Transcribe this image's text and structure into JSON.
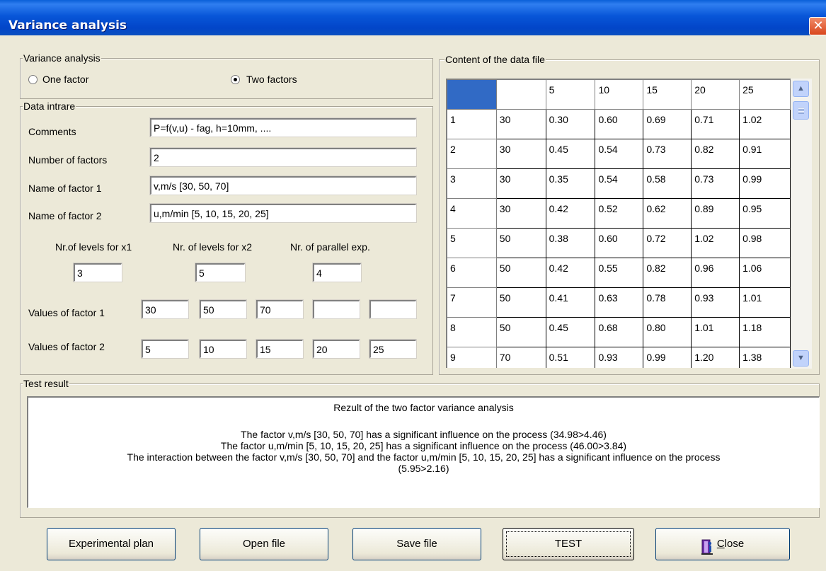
{
  "window": {
    "title": "Variance analysis",
    "close_glyph": "✕"
  },
  "variance": {
    "legend": "Variance analysis",
    "one_factor": "One factor",
    "two_factors": "Two factors",
    "selected": "two_factors"
  },
  "data_intrare": {
    "legend": "Data intrare",
    "comments_label": "Comments",
    "comments_value": "P=f(v,u) - fag, h=10mm, ....",
    "num_factors_label": "Number of factors",
    "num_factors_value": "2",
    "factor1_name_label": "Name of factor 1",
    "factor1_name_value": "v,m/s [30, 50, 70]",
    "factor2_name_label": "Name of factor 2",
    "factor2_name_value": "u,m/min [5, 10, 15, 20, 25]",
    "levels_x1_label": "Nr.of levels for x1",
    "levels_x1_value": "3",
    "levels_x2_label": "Nr. of levels for x2",
    "levels_x2_value": "5",
    "parallel_label": "Nr. of parallel exp.",
    "parallel_value": "4",
    "values_f1_label": "Values of factor 1",
    "values_f1": [
      "30",
      "50",
      "70",
      "",
      ""
    ],
    "values_f2_label": "Values of factor 2",
    "values_f2": [
      "5",
      "10",
      "15",
      "20",
      "25"
    ]
  },
  "datafile": {
    "legend": "Content of the data file",
    "header": [
      "",
      "",
      "5",
      "10",
      "15",
      "20",
      "25"
    ],
    "rows": [
      [
        "1",
        "30",
        "0.30",
        "0.60",
        "0.69",
        "0.71",
        "1.02"
      ],
      [
        "2",
        "30",
        "0.45",
        "0.54",
        "0.73",
        "0.82",
        "0.91"
      ],
      [
        "3",
        "30",
        "0.35",
        "0.54",
        "0.58",
        "0.73",
        "0.99"
      ],
      [
        "4",
        "30",
        "0.42",
        "0.52",
        "0.62",
        "0.89",
        "0.95"
      ],
      [
        "5",
        "50",
        "0.38",
        "0.60",
        "0.72",
        "1.02",
        "0.98"
      ],
      [
        "6",
        "50",
        "0.42",
        "0.55",
        "0.82",
        "0.96",
        "1.06"
      ],
      [
        "7",
        "50",
        "0.41",
        "0.63",
        "0.78",
        "0.93",
        "1.01"
      ],
      [
        "8",
        "50",
        "0.45",
        "0.68",
        "0.80",
        "1.01",
        "1.18"
      ],
      [
        "9",
        "70",
        "0.51",
        "0.93",
        "0.99",
        "1.20",
        "1.38"
      ]
    ]
  },
  "test_result": {
    "legend": "Test result",
    "lines": [
      "Rezult of the two factor variance analysis",
      "",
      "The factor v,m/s [30, 50, 70] has a significant influence on the process (34.98>4.46)",
      "The factor u,m/min [5, 10, 15, 20, 25] has a significant influence on the process (46.00>3.84)",
      "The interaction between the factor v,m/s [30, 50, 70]  and the factor u,m/min [5, 10, 15, 20, 25]  has a significant influence on the process",
      "(5.95>2.16)"
    ]
  },
  "buttons": {
    "experimental_plan": "Experimental plan",
    "open_file": "Open file",
    "save_file": "Save file",
    "test": "TEST",
    "close": "Close"
  },
  "colors": {
    "titlebar": "#0a4fc0",
    "dialog_bg": "#ece9d8",
    "grid_selected": "#316ac5"
  }
}
